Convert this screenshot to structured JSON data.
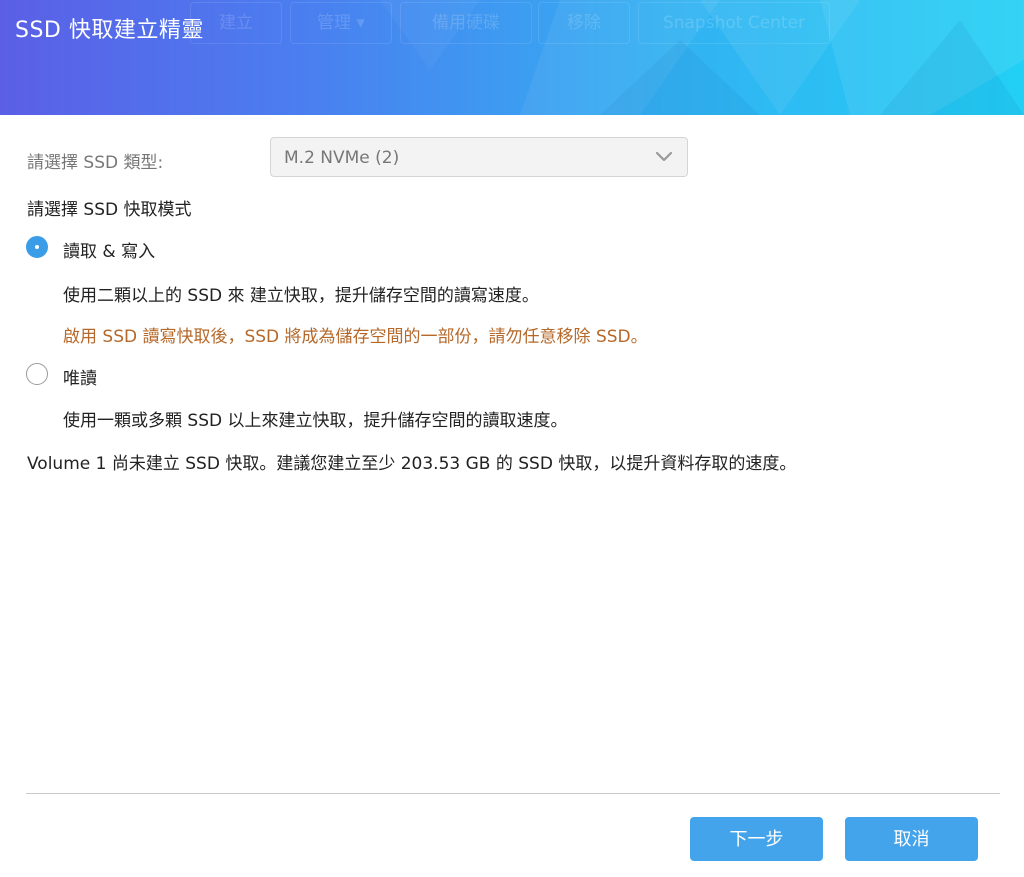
{
  "header": {
    "title": "SSD 快取建立精靈",
    "background_tabs": [
      "建立",
      "管理 ▾",
      "備用硬碟",
      "移除",
      "Snapshot Center"
    ],
    "gradient_colors": [
      "#5b5fe6",
      "#33b1f2",
      "#22d0f5"
    ]
  },
  "form": {
    "ssd_type_label": "請選擇 SSD 類型:",
    "ssd_type_value": "M.2 NVMe (2)",
    "mode_label": "請選擇 SSD 快取模式",
    "options": [
      {
        "label": "讀取 & 寫入",
        "checked": true,
        "description": "使用二顆以上的 SSD 來 建立快取，提升儲存空間的讀寫速度。",
        "warning": "啟用 SSD 讀寫快取後，SSD 將成為儲存空間的一部份，請勿任意移除 SSD。"
      },
      {
        "label": "唯讀",
        "checked": false,
        "description": "使用一顆或多顆 SSD 以上來建立快取，提升儲存空間的讀取速度。"
      }
    ],
    "recommendation": "Volume 1 尚未建立 SSD 快取。建議您建立至少 203.53 GB 的 SSD 快取，以提升資料存取的速度。"
  },
  "footer": {
    "next_label": "下一步",
    "cancel_label": "取消"
  },
  "colors": {
    "accent": "#43a4ec",
    "radio_checked": "#3b9ce8",
    "warning_text": "#b5682a"
  }
}
